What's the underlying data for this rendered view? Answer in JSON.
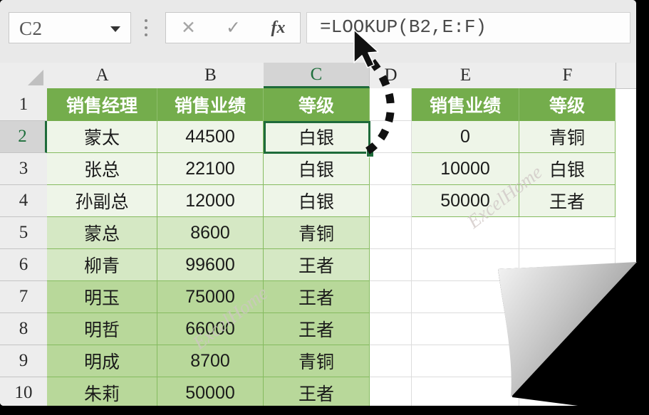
{
  "formula_bar": {
    "name_box_value": "C2",
    "cancel_icon": "close-icon",
    "confirm_icon": "check-icon",
    "function_icon": "fx-icon",
    "formula_value": "=LOOKUP(B2,E:F)"
  },
  "grid": {
    "column_headers": [
      "A",
      "B",
      "C",
      "D",
      "E",
      "F"
    ],
    "selected_column": "C",
    "row_headers": [
      "1",
      "2",
      "3",
      "4",
      "5",
      "6",
      "7",
      "8",
      "9",
      "10"
    ],
    "selected_row": "2",
    "selected_cell": "C2"
  },
  "main_table": {
    "headers": [
      "销售经理",
      "销售业绩",
      "等级"
    ],
    "rows": [
      [
        "蒙太",
        "44500",
        "白银"
      ],
      [
        "张总",
        "22100",
        "白银"
      ],
      [
        "孙副总",
        "12000",
        "白银"
      ],
      [
        "蒙总",
        "8600",
        "青铜"
      ],
      [
        "柳青",
        "99600",
        "王者"
      ],
      [
        "明玉",
        "75000",
        "王者"
      ],
      [
        "明哲",
        "66000",
        "王者"
      ],
      [
        "明成",
        "8700",
        "青铜"
      ],
      [
        "朱莉",
        "50000",
        "王者"
      ]
    ]
  },
  "lookup_table": {
    "headers": [
      "销售业绩",
      "等级"
    ],
    "rows": [
      [
        "0",
        "青铜"
      ],
      [
        "10000",
        "白银"
      ],
      [
        "50000",
        "王者"
      ]
    ]
  },
  "watermarks": [
    "ExcelHome",
    "ExcelHome"
  ],
  "annotation": {
    "arrow_name": "dashed-callout-arrow",
    "cursor_name": "mouse-cursor"
  },
  "colors": {
    "header_green": "#74ad4c",
    "selection_green": "#1e6b3a",
    "band_light": "#eef5e8",
    "band_mid": "#d5e8c4",
    "band_dark": "#b8d89a",
    "gridline": "#85bb5f"
  }
}
